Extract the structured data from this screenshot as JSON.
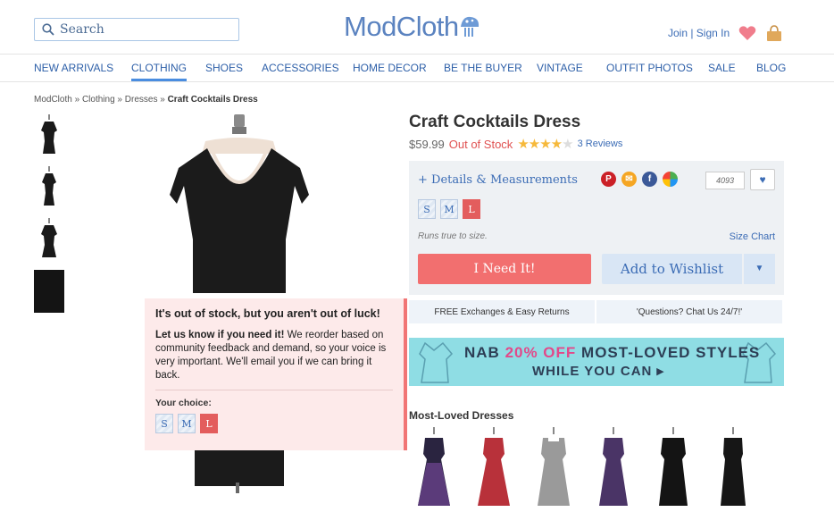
{
  "header": {
    "search_placeholder": "Search",
    "logo_text": "ModCloth",
    "join_sign_in": "Join | Sign In"
  },
  "nav": {
    "items": [
      "NEW ARRIVALS",
      "CLOTHING",
      "SHOES",
      "ACCESSORIES",
      "HOME DECOR",
      "BE THE BUYER",
      "VINTAGE",
      "OUTFIT PHOTOS",
      "SALE",
      "BLOG"
    ],
    "active": "CLOTHING"
  },
  "breadcrumb": {
    "home": "ModCloth",
    "sep": "»",
    "level1": "Clothing",
    "level2": "Dresses",
    "current": "Craft Cocktails Dress"
  },
  "product": {
    "title": "Craft Cocktails Dress",
    "price": "$59.99",
    "stock_status": "Out of Stock",
    "rating": 4,
    "rating_max": 5,
    "reviews": "3 Reviews",
    "details_link": "+ Details & Measurements",
    "loves_count": "4093",
    "sizes": [
      "S",
      "M",
      "L"
    ],
    "selected_size": "L",
    "fit_note": "Runs true to size.",
    "size_chart": "Size Chart",
    "need_button": "I Need It!",
    "wishlist_button": "Add to Wishlist"
  },
  "info_strip": {
    "returns": "FREE Exchanges & Easy Returns",
    "questions": "'Questions? Chat Us 24/7!'"
  },
  "banner": {
    "line1_a": "NAB ",
    "line1_highlight": "20% OFF",
    "line1_b": " MOST-LOVED STYLES",
    "line2": "WHILE YOU CAN ▸"
  },
  "most_loved": {
    "title": "Most-Loved Dresses"
  },
  "popup": {
    "heading": "It's out of stock, but you aren't out of luck!",
    "lead": "Let us know if you need it!",
    "body": " We reorder based on community feedback and demand, so your voice is very important. We'll email you if we can bring it back.",
    "choice_label": "Your choice:",
    "sizes": [
      "S",
      "M",
      "L"
    ],
    "selected_size": "L"
  },
  "colors": {
    "accent": "#3b6cb5",
    "alert": "#e05252",
    "need_button": "#f26f6f",
    "banner": "#8fdde4",
    "popup_bg": "#fdeaea"
  }
}
